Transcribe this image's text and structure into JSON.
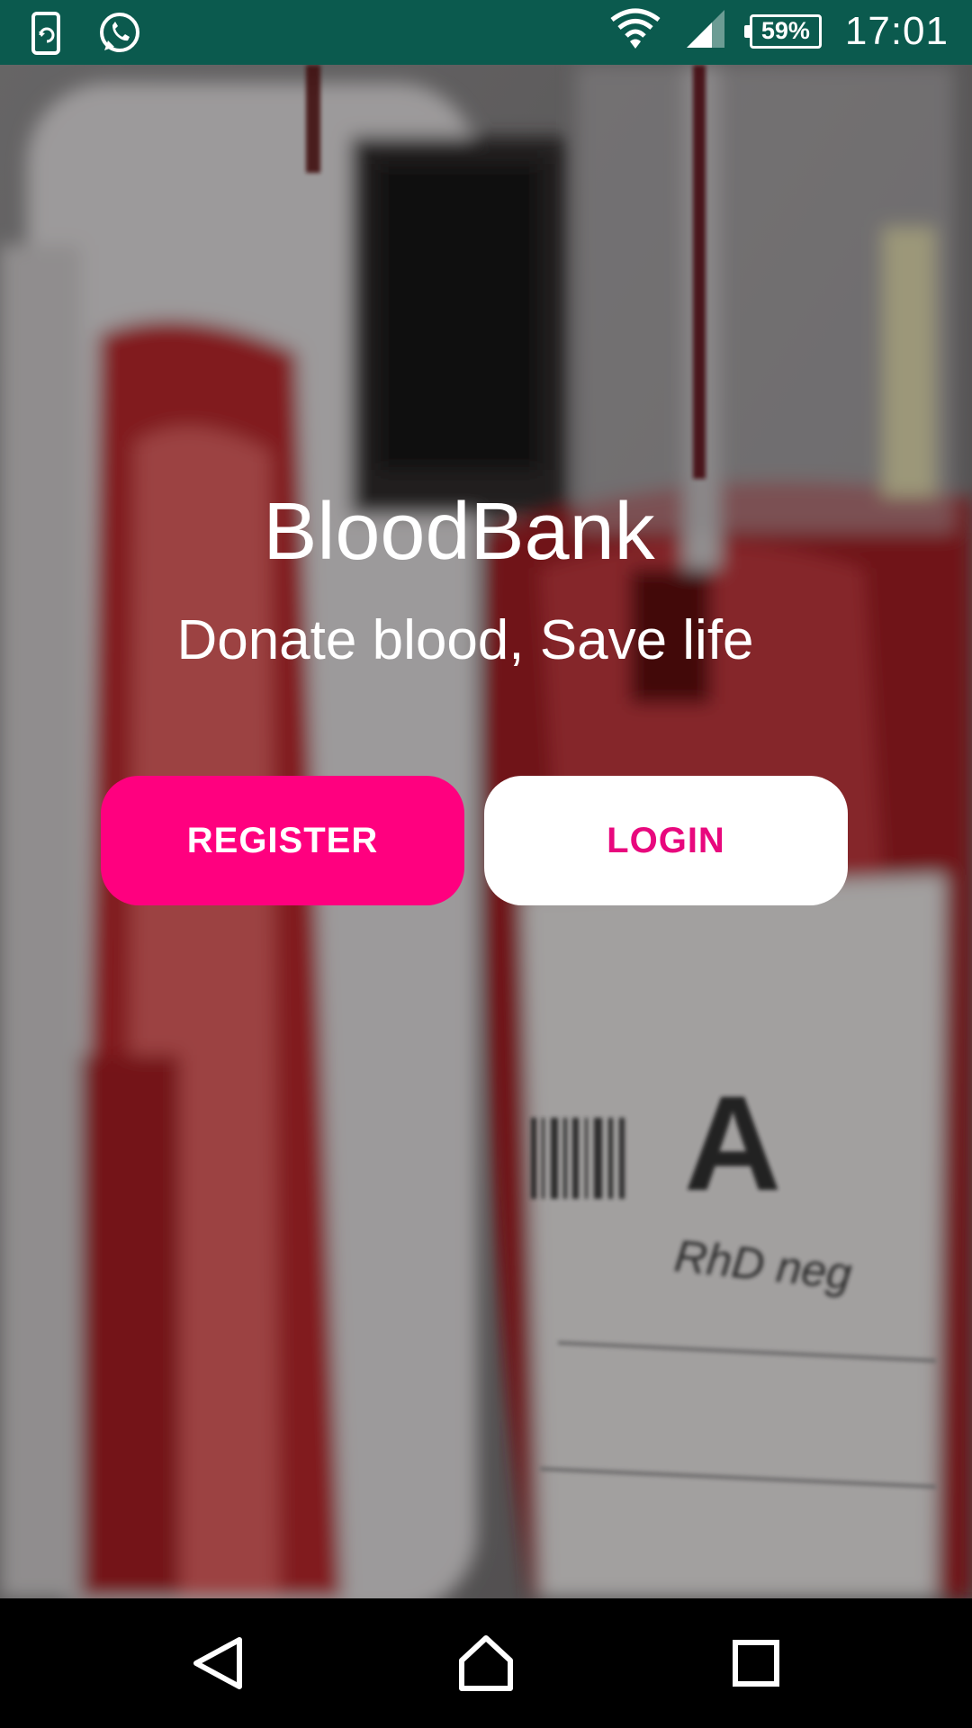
{
  "status_bar": {
    "time": "17:01",
    "battery_percent": "59%",
    "left_icons": [
      "sync-icon",
      "whatsapp-icon"
    ],
    "right_icons": [
      "wifi-icon",
      "signal-icon",
      "battery-icon"
    ]
  },
  "app": {
    "title": "BloodBank",
    "tagline": "Donate blood, Save life"
  },
  "buttons": {
    "register_label": "REGISTER",
    "login_label": "LOGIN"
  },
  "background": {
    "description_icon": "blood-bag-photo",
    "label_text": "A",
    "label_subtext": "RhD neg"
  },
  "nav_bar": {
    "items": [
      "back-icon",
      "home-icon",
      "recents-icon"
    ]
  },
  "colors": {
    "status_bar": "#0b5a4e",
    "accent": "#ff007f",
    "login_text": "#e8087d"
  }
}
